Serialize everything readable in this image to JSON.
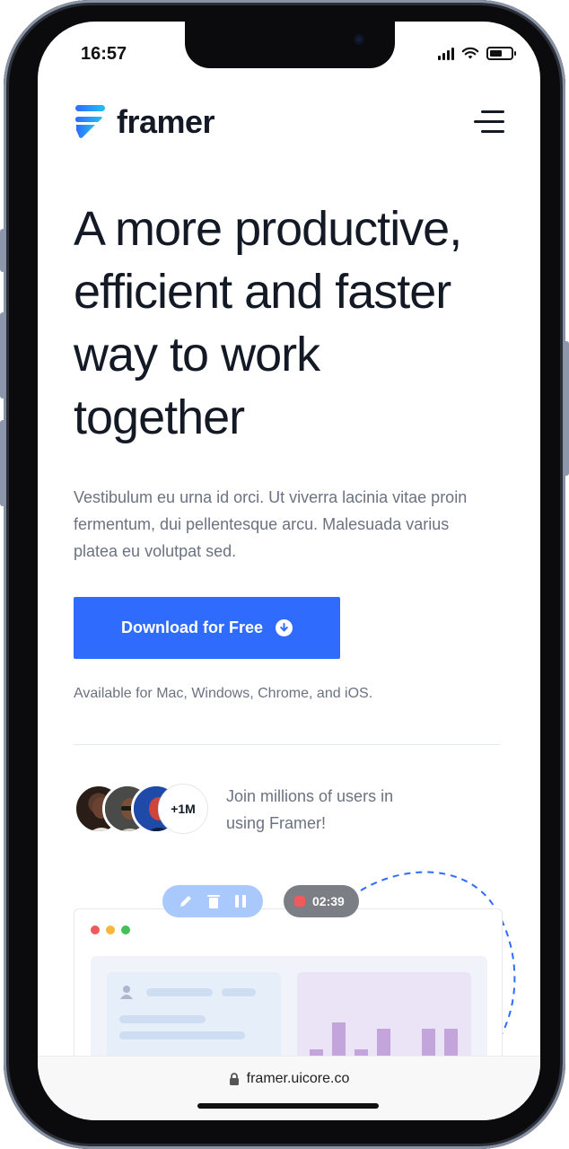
{
  "status_bar": {
    "time": "16:57"
  },
  "header": {
    "logo_text": "framer"
  },
  "hero": {
    "headline_lines": [
      "A more productive,",
      "efficient and faster",
      "way to work",
      "together"
    ],
    "subtext": "Vestibulum eu urna id orci. Ut viverra lacinia vitae proin fermentum, dui pellentesque arcu. Malesuada varius platea eu volutpat sed.",
    "cta_label": "Download for Free",
    "availability": "Available for Mac, Windows, Chrome, and iOS."
  },
  "social_proof": {
    "badge": "+1M",
    "text": "Join millions of users in using Framer!"
  },
  "recorder": {
    "timer": "02:39"
  },
  "browser": {
    "url": "framer.uicore.co"
  },
  "colors": {
    "accent": "#2f6bfd",
    "text": "#131a26",
    "muted": "#6b7280"
  }
}
